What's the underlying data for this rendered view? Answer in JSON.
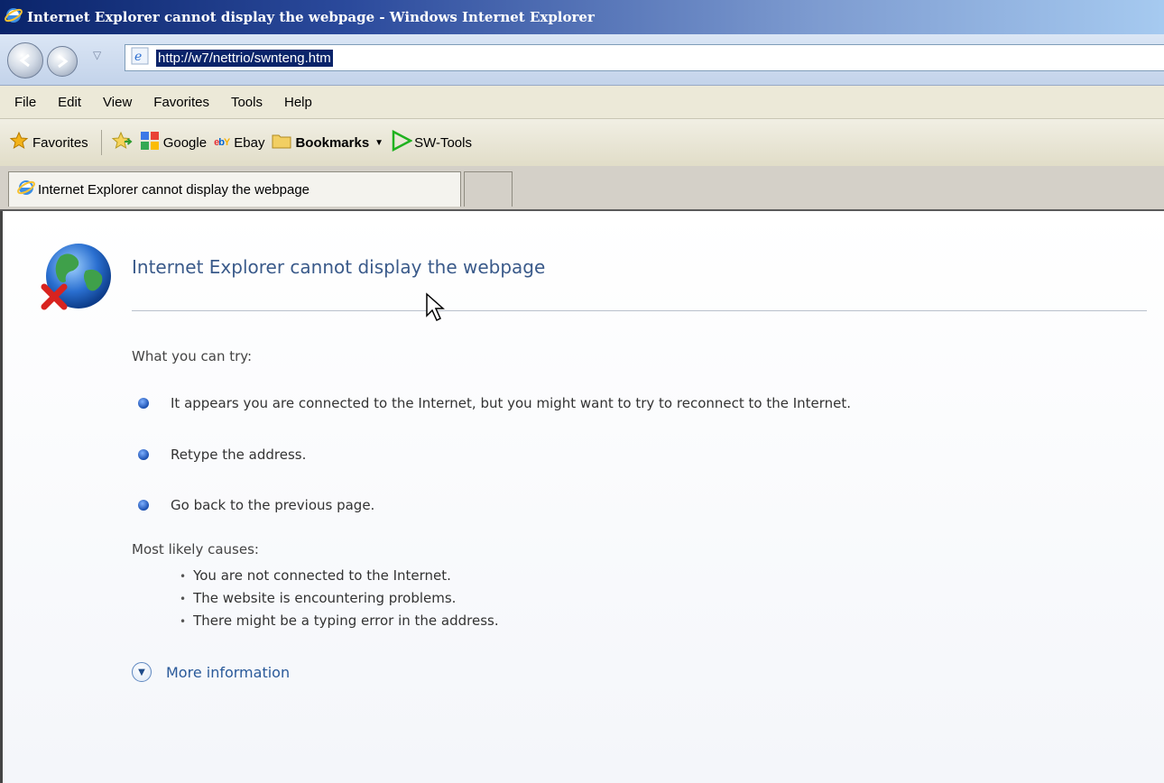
{
  "window": {
    "title": "Internet Explorer cannot display the webpage - Windows Internet Explorer"
  },
  "address": {
    "url": "http://w7/nettrio/swnteng.htm"
  },
  "menu": {
    "items": [
      "File",
      "Edit",
      "View",
      "Favorites",
      "Tools",
      "Help"
    ]
  },
  "favorites_bar": {
    "favorites_label": "Favorites",
    "items": [
      {
        "label": "Google",
        "icon": "google-icon"
      },
      {
        "label": "Ebay",
        "icon": "ebay-icon"
      },
      {
        "label": "Bookmarks",
        "icon": "folder-icon"
      },
      {
        "label": "SW-Tools",
        "icon": "play-arrow-icon"
      }
    ]
  },
  "tab": {
    "label": "Internet Explorer cannot display the webpage"
  },
  "page": {
    "title": "Internet Explorer cannot display the webpage",
    "try_heading": "What you can try:",
    "suggestions": [
      "It appears you are connected to the Internet, but you might want to try to reconnect to the Internet.",
      "Retype the address.",
      "Go back to the previous page."
    ],
    "causes_heading": "Most likely causes:",
    "causes": [
      "You are not connected to the Internet.",
      "The website is encountering problems.",
      "There might be a typing error in the address."
    ],
    "more_info": "More information"
  },
  "colors": {
    "title_text": "#3a5a8a",
    "link": "#2a5a9a",
    "url_highlight": "#0a246a"
  }
}
